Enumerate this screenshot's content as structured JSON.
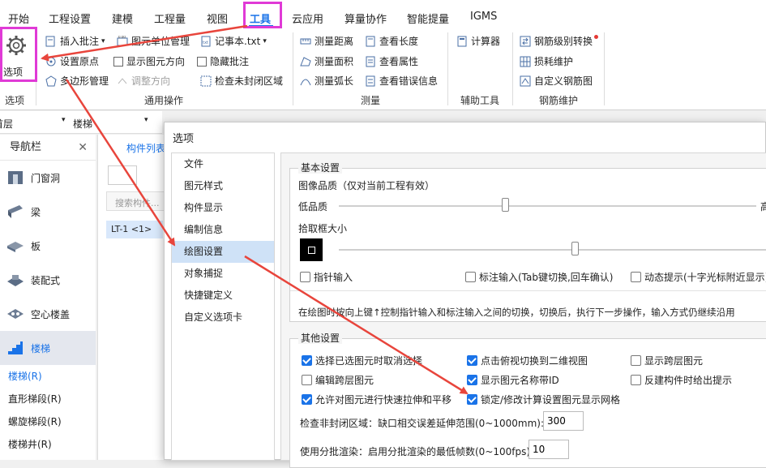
{
  "menu": {
    "items": [
      "开始",
      "工程设置",
      "建模",
      "工程量",
      "视图",
      "工具",
      "云应用",
      "算量协作",
      "智能提量",
      "IGMS"
    ],
    "active": "工具"
  },
  "ribbon": {
    "options_label": "选项",
    "options_group": "选项",
    "general": {
      "insert_note": "插入批注",
      "unit_manage": "图元单位管理",
      "notepad": "记事本.txt",
      "set_origin": "设置原点",
      "show_direction": "显示图元方向",
      "hide_note": "隐藏批注",
      "polygon_manage": "多边形管理",
      "adjust_direction": "调整方向",
      "check_closed": "检查未封闭区域",
      "group": "通用操作"
    },
    "measure": {
      "distance": "测量距离",
      "area": "测量面积",
      "arc": "测量弧长",
      "view_length": "查看长度",
      "view_attr": "查看属性",
      "view_error": "查看错误信息",
      "group": "测量"
    },
    "aux": {
      "calculator": "计算器",
      "group": "辅助工具"
    },
    "rebar": {
      "level_convert": "钢筋级别转换",
      "loss": "损耗维护",
      "custom": "自定义钢筋图",
      "group": "钢筋维护"
    }
  },
  "left": {
    "floor_selector": "首层",
    "type_selector": "楼梯",
    "nav_title": "导航栏",
    "nav_items": [
      "门窗洞",
      "梁",
      "板",
      "装配式",
      "空心楼盖",
      "楼梯"
    ],
    "nav_selected": "楼梯",
    "sub_items": [
      "楼梯(R)",
      "直形梯段(R)",
      "螺旋梯段(R)",
      "楼梯井(R)"
    ],
    "component_list_tab": "构件列表",
    "search_placeholder": "搜索构件...",
    "component_item": "LT-1 <1>"
  },
  "dialog": {
    "title": "选项",
    "categories": [
      "文件",
      "图元样式",
      "构件显示",
      "编制信息",
      "绘图设置",
      "对象捕捉",
      "快捷键定义",
      "自定义选项卡"
    ],
    "selected_category": "绘图设置",
    "basic": {
      "legend": "基本设置",
      "image_quality": "图像品质（仅对当前工程有效）",
      "low": "低品质",
      "high": "高",
      "image_quality_level": 0.4,
      "pick_box": "拾取框大小",
      "pick_box_level": 0.55,
      "pointer_input": "指针输入",
      "dimension_input": "标注输入(Tab键切换,回车确认)",
      "dynamic_hint": "动态提示(十字光标附近显示)",
      "note": "在绘图时按向上键↑控制指针输入和标注输入之间的切换，切换后，执行下一步操作，输入方式仍继续沿用"
    },
    "other": {
      "legend": "其他设置",
      "opt1": "选择已选图元时取消选择",
      "opt2": "点击俯视切换到二维视图",
      "opt3": "显示跨层图元",
      "opt4": "编辑跨层图元",
      "opt5": "显示图元名称带ID",
      "opt6": "反建构件时给出提示",
      "opt7": "允许对图元进行快速拉伸和平移",
      "opt8": "锁定/修改计算设置图元显示网格",
      "check_range_label": "检查非封闭区域：缺口相交误差延伸范围(0~1000mm):",
      "check_range_value": "300",
      "batch_render_label": "使用分批渲染：启用分批渲染的最低帧数(0~100fps):",
      "batch_render_value": "10"
    }
  },
  "colors": {
    "accent": "#1a73e8",
    "highlight": "#e03ad6",
    "arrow": "#e8453c"
  }
}
